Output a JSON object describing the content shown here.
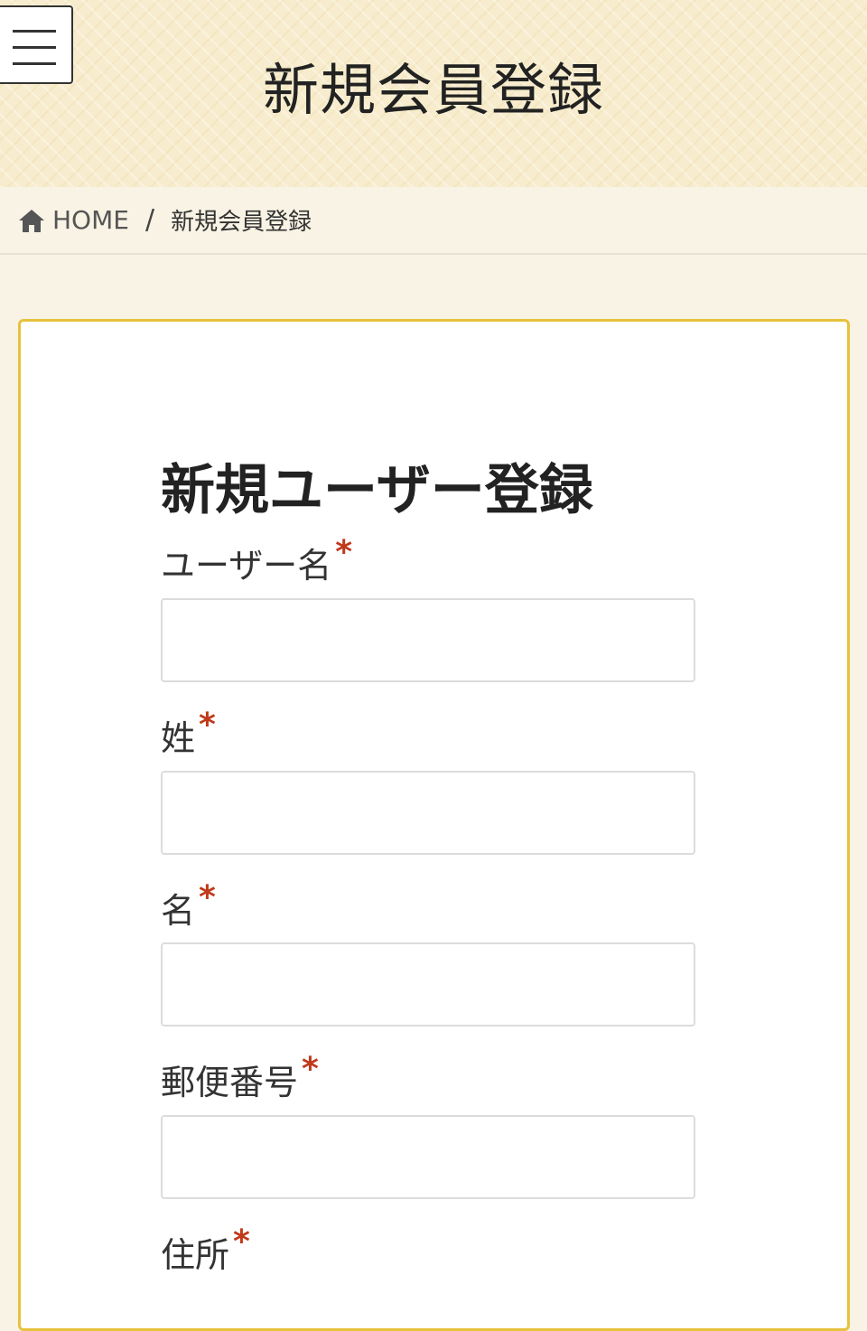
{
  "header": {
    "site_title": "新規会員登録",
    "menu_icon": "hamburger-menu-icon"
  },
  "breadcrumb": {
    "home_icon": "home-icon",
    "home_label": "HOME",
    "separator": "/",
    "current": "新規会員登録"
  },
  "form": {
    "title": "新規ユーザー登録",
    "required_mark": "*",
    "fields": [
      {
        "label": "ユーザー名",
        "value": "",
        "required": true
      },
      {
        "label": "姓",
        "value": "",
        "required": true
      },
      {
        "label": "名",
        "value": "",
        "required": true
      },
      {
        "label": "郵便番号",
        "value": "",
        "required": true
      },
      {
        "label": "住所",
        "value": "",
        "required": true
      }
    ]
  },
  "colors": {
    "card_border": "#e7c23c",
    "required": "#c0391b",
    "page_background": "#f8f3e4"
  }
}
